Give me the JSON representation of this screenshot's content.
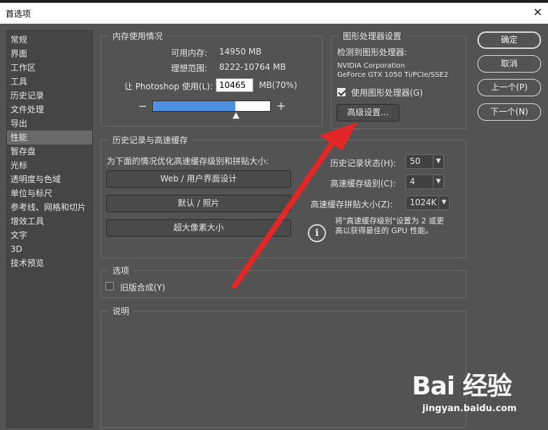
{
  "window": {
    "title": "首选项",
    "close_glyph": "✕"
  },
  "sidebar": {
    "items": [
      {
        "label": "常规"
      },
      {
        "label": "界面"
      },
      {
        "label": "工作区"
      },
      {
        "label": "工具"
      },
      {
        "label": "历史记录"
      },
      {
        "label": "文件处理"
      },
      {
        "label": "导出"
      },
      {
        "label": "性能",
        "selected": true
      },
      {
        "label": "暂存盘"
      },
      {
        "label": "光标"
      },
      {
        "label": "透明度与色域"
      },
      {
        "label": "单位与标尺"
      },
      {
        "label": "参考线、网格和切片"
      },
      {
        "label": "增效工具"
      },
      {
        "label": "文字"
      },
      {
        "label": "3D"
      },
      {
        "label": "技术预览"
      }
    ]
  },
  "memory": {
    "title": "内存使用情况",
    "available_label": "可用内存:",
    "available_value": "14950 MB",
    "ideal_label": "理想范围:",
    "ideal_value": "8222-10764 MB",
    "let_label": "让 Photoshop 使用(L):",
    "let_value": "10465",
    "unit_percent": "MB(70%)",
    "minus": "−",
    "plus": "+",
    "slider_fraction": 0.7
  },
  "gpu": {
    "title": "图形处理器设置",
    "detected_label": "检测到图形处理器:",
    "vendor": "NVIDIA Corporation",
    "model": "GeForce GTX 1050 Ti/PCIe/SSE2",
    "use_gpu_label": "使用图形处理器(G)",
    "use_gpu_checked": true,
    "advanced_button": "高级设置..."
  },
  "history": {
    "title": "历史记录与高速缓存",
    "optimize_label": "为下面的情况优化高速缓存级别和拼贴大小:",
    "preset_web": "Web / 用户界面设计",
    "preset_default": "默认 / 照片",
    "preset_huge": "超大像素大小",
    "states_label": "历史记录状态(H):",
    "states_value": "50",
    "cache_levels_label": "高速缓存级别(C):",
    "cache_levels_value": "4",
    "tile_size_label": "高速缓存拼贴大小(Z):",
    "tile_size_value": "1024K",
    "info_line1": "将\"高速缓存级别\"设置为 2 或更",
    "info_line2": "高以获得最佳的 GPU 性能。"
  },
  "options": {
    "title": "选项",
    "legacy_label": "旧版合成(Y)",
    "legacy_checked": false
  },
  "description": {
    "title": "说明"
  },
  "buttons": {
    "ok": "确定",
    "cancel": "取消",
    "prev": "上一个(P)",
    "next": "下一个(N)"
  },
  "watermark": {
    "brand": "Bai 经验",
    "url": "jingyan.baidu.com"
  },
  "colors": {
    "accent_blue": "#4d8fe3",
    "arrow_red": "#e32626",
    "panel_bg": "#535353"
  }
}
